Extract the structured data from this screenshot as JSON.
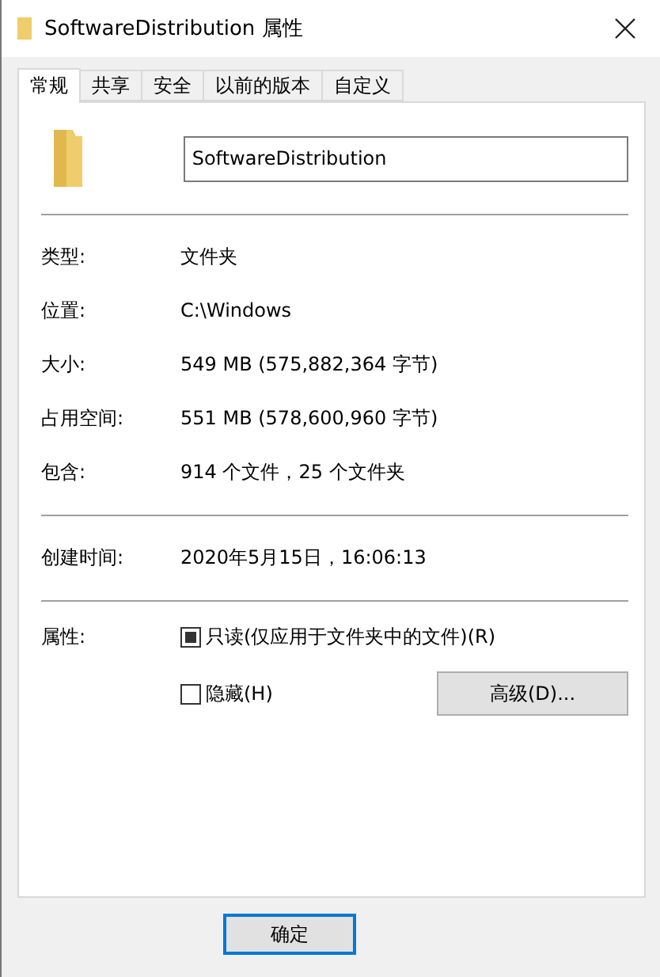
{
  "window": {
    "title": "SoftwareDistribution 属性"
  },
  "tabs": [
    {
      "label": "常规",
      "selected": true
    },
    {
      "label": "共享",
      "selected": false
    },
    {
      "label": "安全",
      "selected": false
    },
    {
      "label": "以前的版本",
      "selected": false
    },
    {
      "label": "自定义",
      "selected": false
    }
  ],
  "name_field": {
    "value": "SoftwareDistribution"
  },
  "groups": [
    [
      {
        "label": "类型:",
        "value": "文件夹"
      },
      {
        "label": "位置:",
        "value": "C:\\Windows"
      },
      {
        "label": "大小:",
        "value": "549 MB (575,882,364 字节)"
      },
      {
        "label": "占用空间:",
        "value": "551 MB (578,600,960 字节)"
      },
      {
        "label": "包含:",
        "value": "914 个文件，25 个文件夹"
      }
    ],
    [
      {
        "label": "创建时间:",
        "value": "2020年5月15日，16:06:13"
      }
    ]
  ],
  "attributes": {
    "label": "属性:",
    "checkboxes": [
      {
        "label": "只读(仅应用于文件夹中的文件)(R)",
        "mixed": true
      },
      {
        "label": "隐藏(H)",
        "mixed": false
      }
    ],
    "advanced_button": "高级(D)..."
  },
  "buttons": [
    {
      "label": "确定",
      "default": true
    }
  ]
}
